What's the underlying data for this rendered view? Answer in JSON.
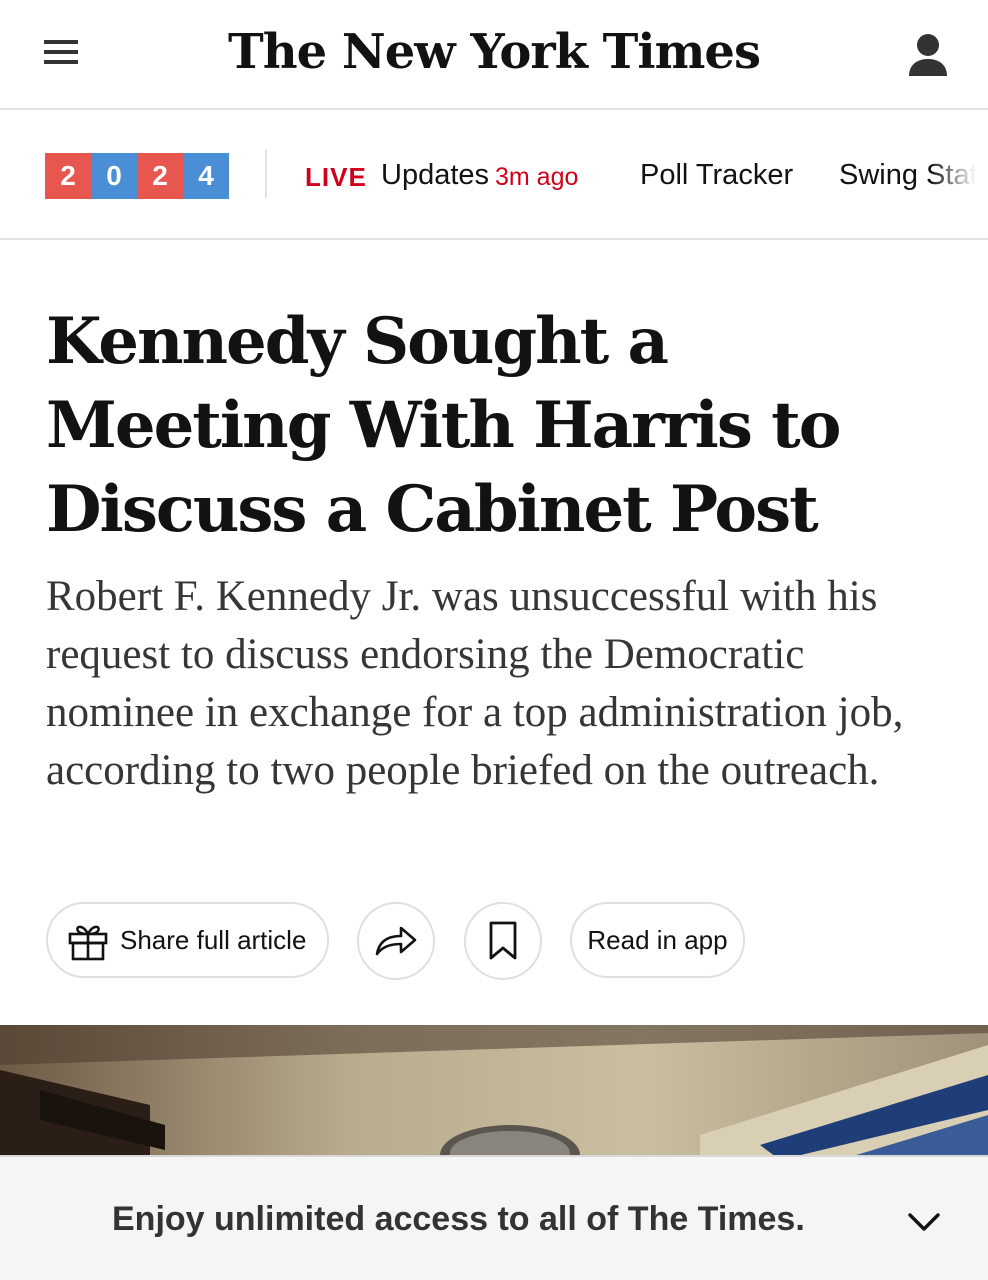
{
  "header": {
    "logo_text": "The New York Times"
  },
  "election_nav": {
    "year_digits": [
      "2",
      "0",
      "2",
      "4"
    ],
    "live_label": "LIVE",
    "updates_label": "Updates",
    "time_ago": "3m ago",
    "poll_tracker": "Poll Tracker",
    "swing_states": "Swing States"
  },
  "article": {
    "headline": "Kennedy Sought a Meeting With Harris to Discuss a Cabinet Post",
    "summary": "Robert F. Kennedy Jr. was unsuccessful with his request to discuss endorsing the Democratic nominee in exchange for a top administration job, according to two people briefed on the outreach."
  },
  "actions": {
    "share_label": "Share full article",
    "read_in_app_label": "Read in app"
  },
  "banner": {
    "text": "Enjoy unlimited access to all of The Times."
  },
  "icons": {
    "menu": "hamburger-menu-icon",
    "account": "person-icon",
    "gift": "gift-icon",
    "share": "share-arrow-icon",
    "save": "bookmark-icon",
    "collapse": "chevron-down-icon"
  },
  "colors": {
    "live_red": "#d0021b",
    "year_red": "#e8574f",
    "year_blue": "#4a8fd6",
    "text": "#121212"
  }
}
